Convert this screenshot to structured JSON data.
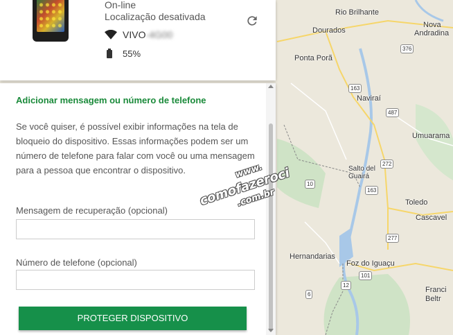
{
  "device": {
    "status": "On-line",
    "location": "Localização desativada",
    "network": "VIVO",
    "network_hidden": "-4G00",
    "battery": "55%"
  },
  "icons": {
    "refresh": "refresh-icon",
    "wifi": "wifi-icon",
    "battery": "battery-icon"
  },
  "form": {
    "title": "Adicionar mensagem ou número de telefone",
    "description": "Se você quiser, é possível exibir informações na tela de bloqueio do dispositivo. Essas informações podem ser um número de telefone para falar com você ou uma mensagem para a pessoa que encontrar o dispositivo.",
    "message_label": "Mensagem de recuperação (opcional)",
    "message_value": "",
    "phone_label": "Número de telefone (opcional)",
    "phone_value": "",
    "submit_label": "PROTEGER DISPOSITIVO"
  },
  "watermark": {
    "line1": "www.",
    "line2": "comofazeroci",
    "line3": ".com.br"
  },
  "map": {
    "cities": [
      {
        "name": "Rio Brilhante"
      },
      {
        "name": "Dourados"
      },
      {
        "name": "Nova"
      },
      {
        "name": "Andradina"
      },
      {
        "name": "Ponta Porã"
      },
      {
        "name": "Naviraí"
      },
      {
        "name": "Umuarama"
      },
      {
        "name": "Salto del Guairá"
      },
      {
        "name": "Toledo"
      },
      {
        "name": "Cascavel"
      },
      {
        "name": "Hernandarias"
      },
      {
        "name": "Foz do Iguaçu"
      },
      {
        "name": "Franci Beltr"
      }
    ],
    "routes": [
      "376",
      "163",
      "487",
      "272",
      "10",
      "163",
      "277",
      "101",
      "12",
      "6"
    ],
    "colors": {
      "water": "#a8c8e8",
      "land": "#ece8dc",
      "green": "#c8e0c0",
      "road": "#f6d66a",
      "border": "#888888"
    }
  }
}
